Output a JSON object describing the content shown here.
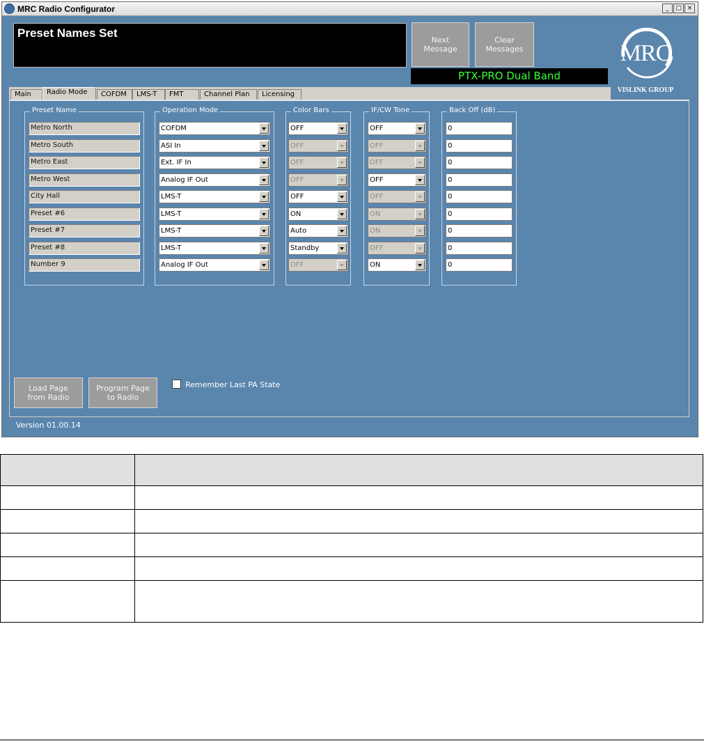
{
  "window": {
    "title": "MRC Radio Configurator",
    "controls": {
      "minimize": "_",
      "maximize": "□",
      "close": "×"
    }
  },
  "message_box": {
    "text": "Preset Names Set"
  },
  "buttons": {
    "next_message": "Next\nMessage",
    "clear_messages": "Clear\nMessages",
    "load_page": "Load Page\nfrom Radio",
    "program_page": "Program Page\nto Radio"
  },
  "device_label": "PTX-PRO Dual Band",
  "logo": {
    "text": "MRC",
    "sub": "VISLINK GROUP"
  },
  "tabs": [
    {
      "label": "Main"
    },
    {
      "label": "Radio Mode"
    },
    {
      "label": "COFDM"
    },
    {
      "label": "LMS-T"
    },
    {
      "label": "FMT"
    },
    {
      "label": "Channel Plan"
    },
    {
      "label": "Licensing"
    }
  ],
  "groups": {
    "preset_name": "Preset Name",
    "operation_mode": "Operation Mode",
    "color_bars": "Color Bars",
    "if_cw_tone": "IF/CW Tone",
    "back_off": "Back Off (dB)"
  },
  "rows": [
    {
      "preset": "Metro North",
      "mode": "COFDM",
      "color": "OFF",
      "color_enabled": true,
      "tone": "OFF",
      "tone_enabled": true,
      "backoff": "0"
    },
    {
      "preset": "Metro South",
      "mode": "ASI In",
      "color": "OFF",
      "color_enabled": false,
      "tone": "OFF",
      "tone_enabled": false,
      "backoff": "0"
    },
    {
      "preset": "Metro East",
      "mode": "Ext. IF In",
      "color": "OFF",
      "color_enabled": false,
      "tone": "OFF",
      "tone_enabled": false,
      "backoff": "0"
    },
    {
      "preset": "Metro West",
      "mode": "Analog IF Out",
      "color": "OFF",
      "color_enabled": false,
      "tone": "OFF",
      "tone_enabled": true,
      "backoff": "0"
    },
    {
      "preset": "City Hall",
      "mode": "LMS-T",
      "color": "OFF",
      "color_enabled": true,
      "tone": "OFF",
      "tone_enabled": false,
      "backoff": "0"
    },
    {
      "preset": "Preset #6",
      "mode": "LMS-T",
      "color": "ON",
      "color_enabled": true,
      "tone": "ON",
      "tone_enabled": false,
      "backoff": "0"
    },
    {
      "preset": "Preset #7",
      "mode": "LMS-T",
      "color": "Auto",
      "color_enabled": true,
      "tone": "ON",
      "tone_enabled": false,
      "backoff": "0"
    },
    {
      "preset": "Preset #8",
      "mode": "LMS-T",
      "color": "Standby",
      "color_enabled": true,
      "tone": "OFF",
      "tone_enabled": false,
      "backoff": "0"
    },
    {
      "preset": "Number 9",
      "mode": "Analog IF Out",
      "color": "OFF",
      "color_enabled": false,
      "tone": "ON",
      "tone_enabled": true,
      "backoff": "0"
    }
  ],
  "remember_pa": {
    "label": "Remember Last PA State",
    "checked": false
  },
  "version": "Version 01.00.14"
}
